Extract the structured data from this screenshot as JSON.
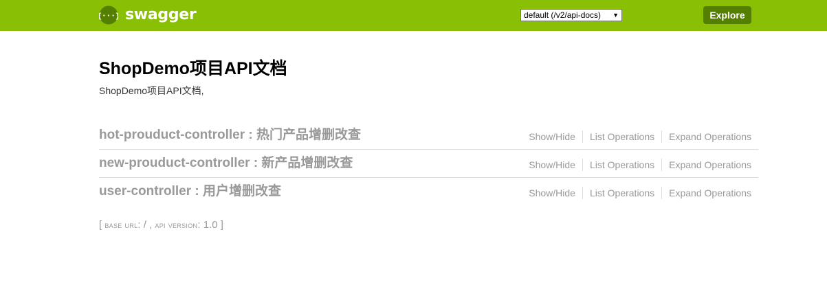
{
  "header": {
    "logo_text": "swagger",
    "logo_icon": "swagger-braces-icon",
    "spec_select_value": "default (/v2/api-docs)",
    "explore_label": "Explore",
    "brand_color": "#89bf04",
    "explore_color": "#547f00"
  },
  "info": {
    "title": "ShopDemo项目API文档",
    "description": "ShopDemo项目API文档,"
  },
  "resources": [
    {
      "title": "hot-prouduct-controller : 热门产品增删改查",
      "show_hide": "Show/Hide",
      "list_ops": "List Operations",
      "expand_ops": "Expand Operations"
    },
    {
      "title": "new-prouduct-controller : 新产品增删改查",
      "show_hide": "Show/Hide",
      "list_ops": "List Operations",
      "expand_ops": "Expand Operations"
    },
    {
      "title": "user-controller : 用户增删改查",
      "show_hide": "Show/Hide",
      "list_ops": "List Operations",
      "expand_ops": "Expand Operations"
    }
  ],
  "footer": {
    "open_bracket": "[",
    "base_url_label": "base url",
    "base_url_value": "/",
    "separator": ",",
    "api_version_label": "api version",
    "api_version_value": "1.0",
    "close_bracket": "]"
  }
}
